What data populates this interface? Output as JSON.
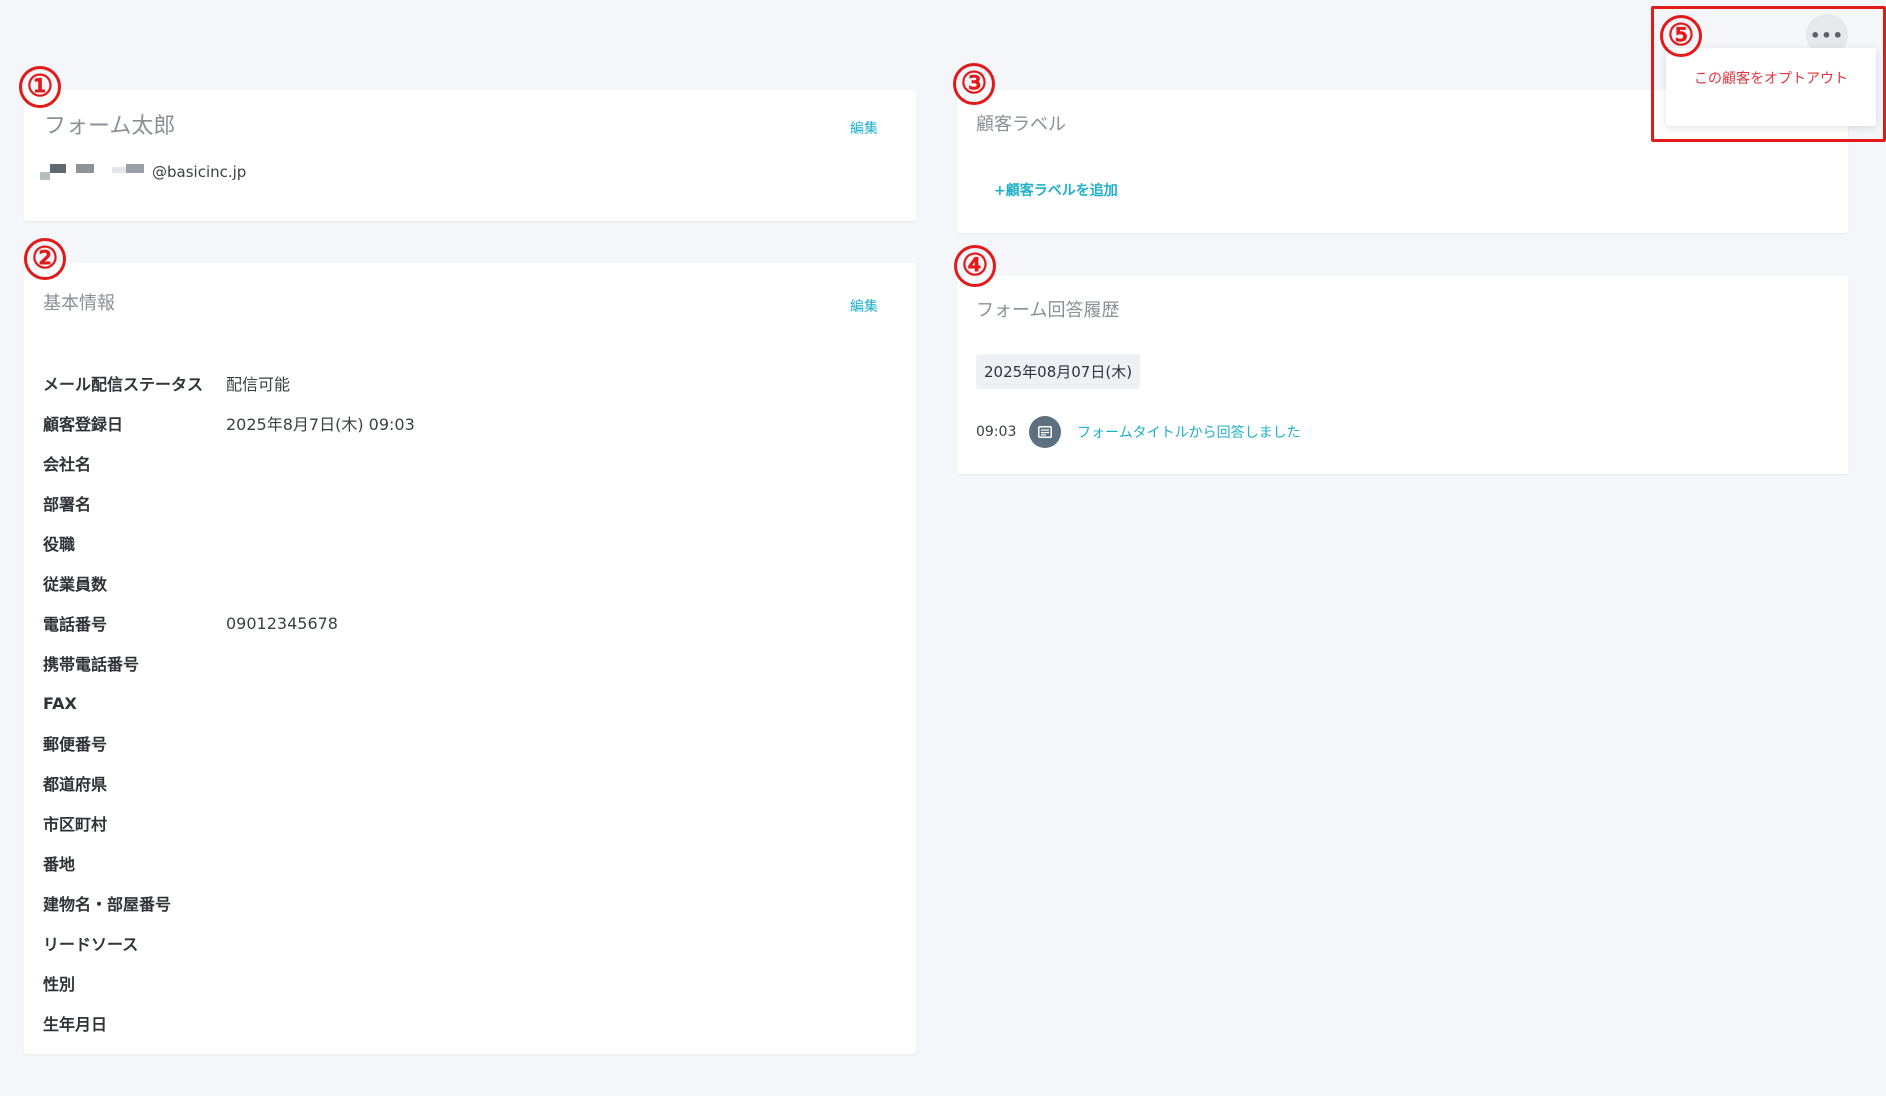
{
  "profile": {
    "name": "フォーム太郎",
    "edit_label": "編集",
    "email_suffix": "@basicinc.jp"
  },
  "basic_info": {
    "title": "基本情報",
    "edit_label": "編集",
    "rows": [
      {
        "label": "メール配信ステータス",
        "value": "配信可能"
      },
      {
        "label": "顧客登録日",
        "value": "2025年8月7日(木) 09:03"
      },
      {
        "label": "会社名",
        "value": ""
      },
      {
        "label": "部署名",
        "value": ""
      },
      {
        "label": "役職",
        "value": ""
      },
      {
        "label": "従業員数",
        "value": ""
      },
      {
        "label": "電話番号",
        "value": "09012345678"
      },
      {
        "label": "携帯電話番号",
        "value": ""
      },
      {
        "label": "FAX",
        "value": ""
      },
      {
        "label": "郵便番号",
        "value": ""
      },
      {
        "label": "都道府県",
        "value": ""
      },
      {
        "label": "市区町村",
        "value": ""
      },
      {
        "label": "番地",
        "value": ""
      },
      {
        "label": "建物名・部屋番号",
        "value": ""
      },
      {
        "label": "リードソース",
        "value": ""
      },
      {
        "label": "性別",
        "value": ""
      },
      {
        "label": "生年月日",
        "value": ""
      }
    ]
  },
  "labels": {
    "title": "顧客ラベル",
    "add_label": "+顧客ラベルを追加"
  },
  "history": {
    "title": "フォーム回答履歴",
    "date": "2025年08月07日(木)",
    "entries": [
      {
        "time": "09:03",
        "text": "フォームタイトルから回答しました"
      }
    ]
  },
  "menu": {
    "more_label": "•••",
    "optout_label": "この顧客をオプトアウト"
  },
  "markers": [
    "①",
    "②",
    "③",
    "④",
    "⑤"
  ],
  "colors": {
    "accent": "#1fb0c8",
    "danger": "#e3343c",
    "annotation": "#e21a1a",
    "background": "#f5f6fa"
  }
}
